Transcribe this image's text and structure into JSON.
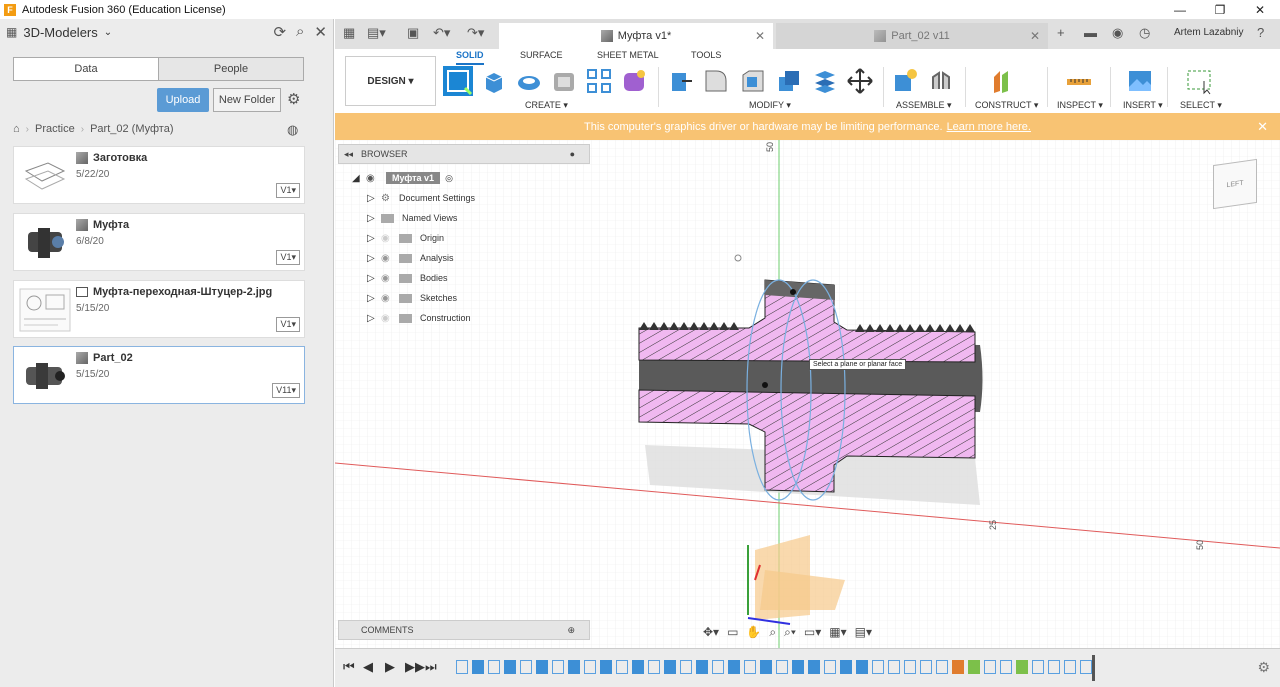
{
  "window": {
    "title": "Autodesk Fusion 360 (Education License)",
    "icon_letter": "F",
    "minimize": "—",
    "restore": "❐",
    "close": "✕"
  },
  "left_panel": {
    "project": "3D-Modelers",
    "tabs": [
      "Data",
      "People"
    ],
    "upload": "Upload",
    "new_folder": "New Folder",
    "breadcrumb": [
      "Practice",
      "Part_02 (Муфта)"
    ],
    "files": [
      {
        "name": "Заготовка",
        "date": "5/22/20",
        "version": "V1"
      },
      {
        "name": "Муфта",
        "date": "6/8/20",
        "version": "V1"
      },
      {
        "name": "Муфта-переходная-Штуцер-2.jpg",
        "date": "5/15/20",
        "version": "V1"
      },
      {
        "name": "Part_02",
        "date": "5/15/20",
        "version": "V11"
      }
    ]
  },
  "tabs": {
    "active": "Муфта v1*",
    "inactive": "Part_02 v11",
    "user": "Artem Lazabniy"
  },
  "toolbar": {
    "workspace": "DESIGN ▾",
    "tabs": [
      "SOLID",
      "SURFACE",
      "SHEET METAL",
      "TOOLS"
    ],
    "groups": [
      "CREATE ▾",
      "MODIFY ▾",
      "ASSEMBLE ▾",
      "CONSTRUCT ▾",
      "INSPECT ▾",
      "INSERT ▾",
      "SELECT ▾"
    ]
  },
  "warning": {
    "text": "This computer's graphics driver or hardware may be limiting performance.",
    "link": "Learn more here."
  },
  "browser": {
    "title": "BROWSER",
    "root": "Муфта v1",
    "items": [
      "Document Settings",
      "Named Views",
      "Origin",
      "Analysis",
      "Bodies",
      "Sketches",
      "Construction"
    ]
  },
  "comments": "COMMENTS",
  "canvas": {
    "tooltip": "Select a plane or planar face",
    "axis_labels": [
      "50",
      "25",
      "50"
    ],
    "viewcube": "LEFT"
  },
  "colors": {
    "accent": "#1b74c7",
    "warning": "#f8c373",
    "section_fill": "#f0b8f0",
    "upload": "#5b9bd5"
  }
}
